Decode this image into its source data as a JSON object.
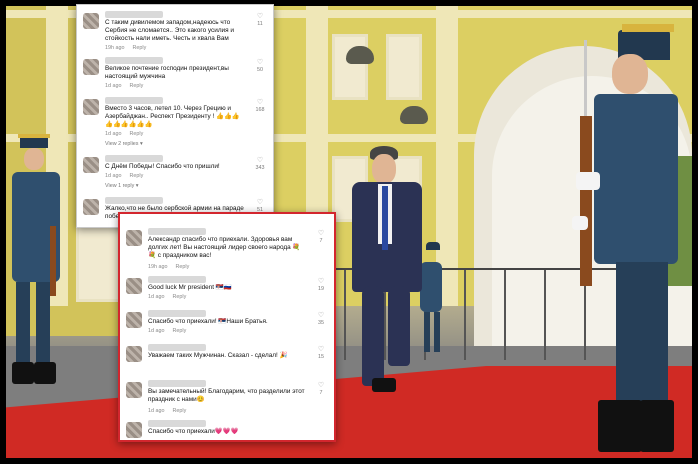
{
  "colors": {
    "carpet": "#d02a24",
    "facade": "#dccf62",
    "panel_border_highlight": "#d3262e"
  },
  "panel_a": {
    "comments": [
      {
        "text": "С таким дивилемом западом,надеюсь что Сербия не сломается.. Это какого усилия и стойкость нали иметь. Честь и хвала Вам",
        "time": "19h ago",
        "reply": "Reply",
        "likes": "11"
      },
      {
        "text": "Великое почтение господин президент,вы настоящий мужчина",
        "time": "1d ago",
        "reply": "Reply",
        "likes": "50"
      },
      {
        "text": "Вместо 3 часов, летел 10. Через Грецию и Азербайджан.. Респект Президенту ! 👍👍👍👍👍👍👍👍👍",
        "time": "1d ago",
        "reply": "Reply",
        "likes": "168",
        "more": "View 2 replies ▾"
      },
      {
        "text": "С Днём Победы! Спасибо что пришли!",
        "time": "1d ago",
        "reply": "Reply",
        "likes": "343",
        "more": "View 1 reply ▾"
      },
      {
        "text": "Жалко,что не было сербской армии на параде победы.Очень хотелось бы их там видеть",
        "time": "",
        "reply": "",
        "likes": "51"
      }
    ]
  },
  "panel_b": {
    "comments": [
      {
        "text": "Александр спасибо что приехали. Здоровья вам долгих лет! Вы настоящий лидер своего народа 💐💐 с праздником вас!",
        "time": "19h ago",
        "reply": "Reply",
        "likes": "7"
      },
      {
        "text": "Good luck Mr president 🇷🇸🇷🇺",
        "time": "1d ago",
        "reply": "Reply",
        "likes": "19"
      },
      {
        "text": "Спасибо что приехали! 🇷🇸Наши Братья.",
        "time": "1d ago",
        "reply": "Reply",
        "likes": "35"
      },
      {
        "text": "Уважаем таких Мужчинaн. Сказал - сделал! 🎉",
        "time": "",
        "reply": "",
        "likes": "15"
      },
      {
        "text": "Вы замечательный! Благодарим, что разделили этот праздник с нами😊",
        "time": "1d ago",
        "reply": "Reply",
        "likes": "7"
      },
      {
        "text": "Спасибо что приехали💗💗💗",
        "time": "",
        "reply": "",
        "likes": ""
      }
    ]
  },
  "icons": {
    "like": "heart-outline-icon"
  }
}
